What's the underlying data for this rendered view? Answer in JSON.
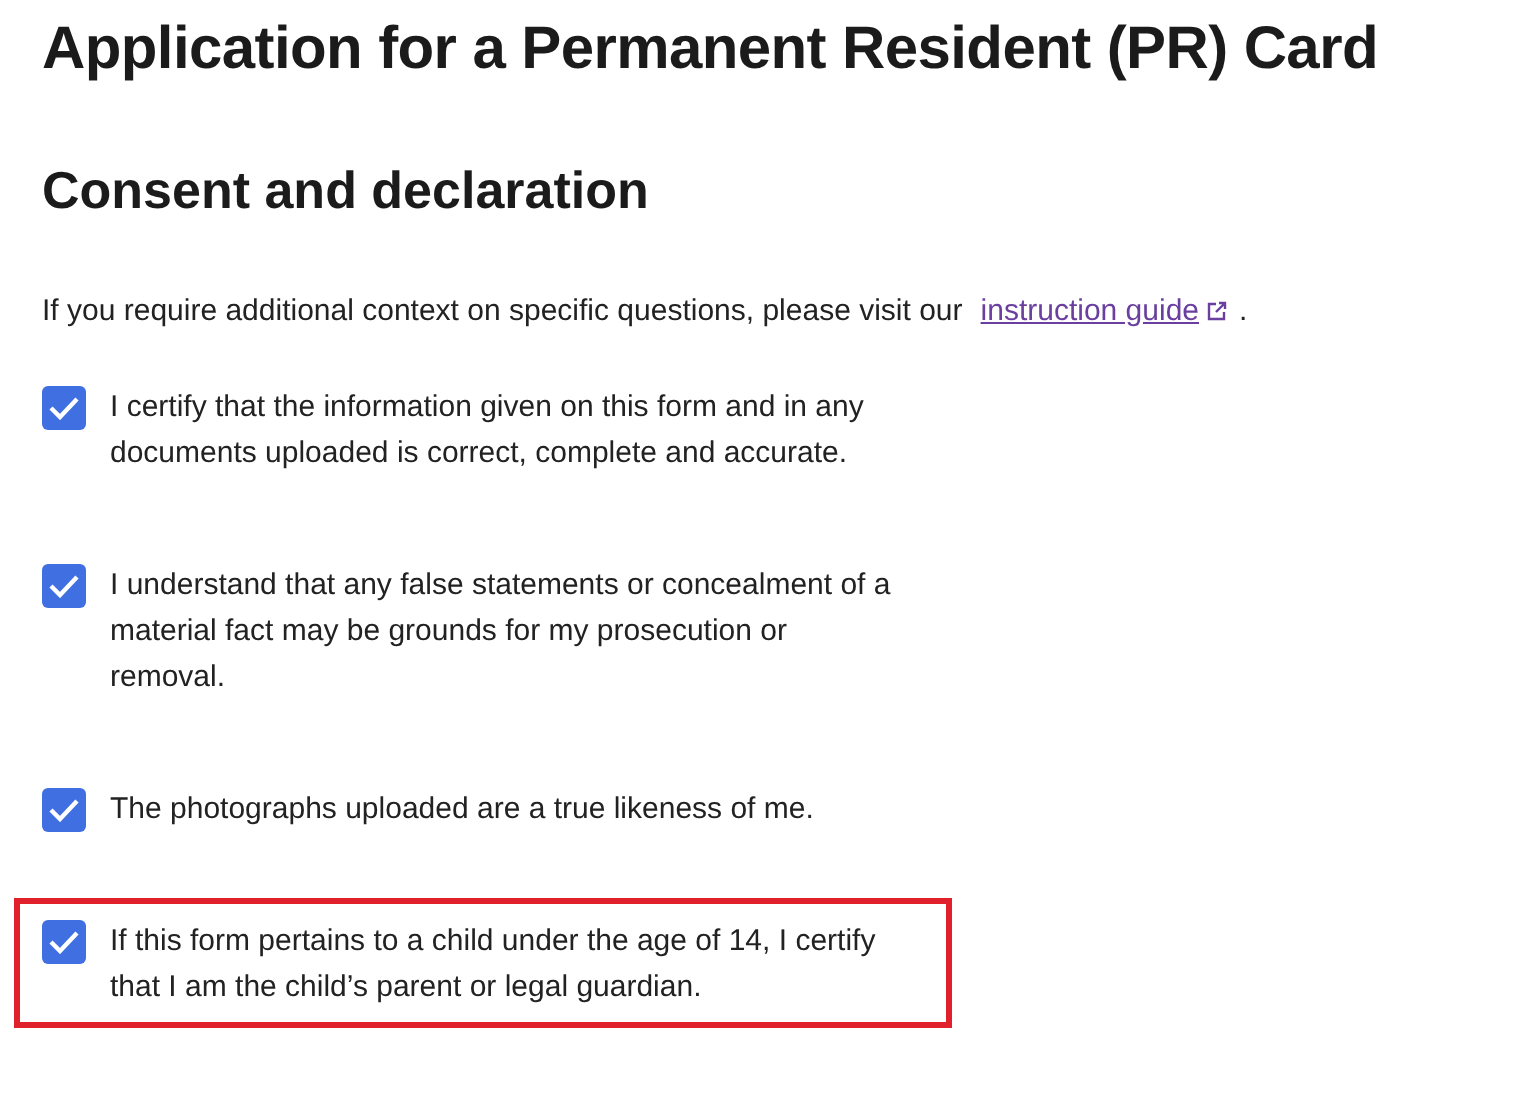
{
  "title": "Application for a Permanent Resident (PR) Card",
  "section_title": "Consent and declaration",
  "intro": {
    "text": "If you require additional context on specific questions, please visit our",
    "link": "instruction guide",
    "after": "."
  },
  "declarations": [
    {
      "text": "I certify that the information given on this form and in any documents uploaded is correct, complete and accurate.",
      "checked": true,
      "highlighted": false
    },
    {
      "text": "I understand that any false statements or concealment of a material fact may be grounds for my prosecution or removal.",
      "checked": true,
      "highlighted": false
    },
    {
      "text": "The photographs uploaded are a true likeness of me.",
      "checked": true,
      "highlighted": false
    },
    {
      "text": "If this form pertains to a child under the age of 14, I certify that I am the child’s parent or legal guardian.",
      "checked": true,
      "highlighted": true
    }
  ]
}
